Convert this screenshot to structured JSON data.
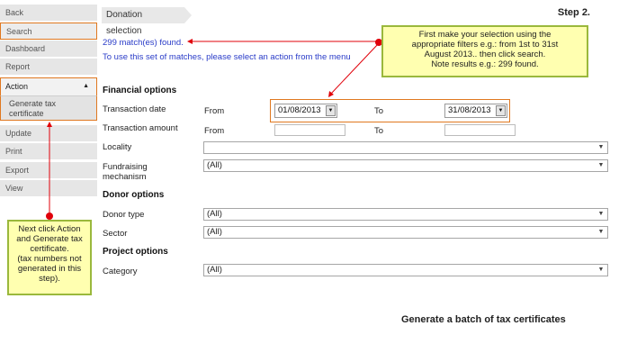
{
  "sidebar": {
    "items": [
      {
        "label": "Back"
      },
      {
        "label": "Search"
      },
      {
        "label": "Dashboard"
      },
      {
        "label": "Report"
      }
    ],
    "action": {
      "label": "Action",
      "caret": "▲",
      "sub_item": "Generate tax certificate"
    },
    "items_after": [
      {
        "label": "Update"
      },
      {
        "label": "Print"
      },
      {
        "label": "Export"
      },
      {
        "label": "View"
      }
    ]
  },
  "header": {
    "tab": "Donation selection",
    "step": "Step 2."
  },
  "results": {
    "match_text": "299 match(es) found.",
    "hint": "To use this set of matches, please select an action from the menu"
  },
  "financial": {
    "section": "Financial options",
    "transaction_date": {
      "label": "Transaction date",
      "from_label": "From",
      "from_value": "01/08/2013",
      "to_label": "To",
      "to_value": "31/08/2013"
    },
    "transaction_amount": {
      "label": "Transaction amount",
      "from_label": "From",
      "to_label": "To"
    },
    "locality": {
      "label": "Locality",
      "value": ""
    },
    "fundraising": {
      "label_line1": "Fundraising",
      "label_line2": "mechanism",
      "value": "(All)"
    }
  },
  "donor": {
    "section": "Donor options",
    "donor_type": {
      "label": "Donor type",
      "value": "(All)"
    },
    "sector": {
      "label": "Sector",
      "value": "(All)"
    }
  },
  "project": {
    "section": "Project options",
    "category": {
      "label": "Category",
      "value": "(All)"
    }
  },
  "callouts": {
    "top": [
      "First make your selection using the",
      "appropriate filters e.g.: from 1st  to 31st",
      "August 2013.. then click search.",
      "Note results e.g.: 299 found."
    ],
    "left": [
      "Next click Action",
      "and Generate tax",
      "certificate.",
      "(tax numbers not",
      "generated in this",
      "step)."
    ]
  },
  "footer": "Generate a batch of tax certificates",
  "colors": {
    "accent_border": "#e07820",
    "link_blue": "#2a3cc8",
    "callout_fill": "#ffffb0",
    "callout_border": "#9ab83c",
    "pointer_red": "#e0000a"
  },
  "icons": {
    "dropdown": "▼",
    "arrow": "▶"
  }
}
